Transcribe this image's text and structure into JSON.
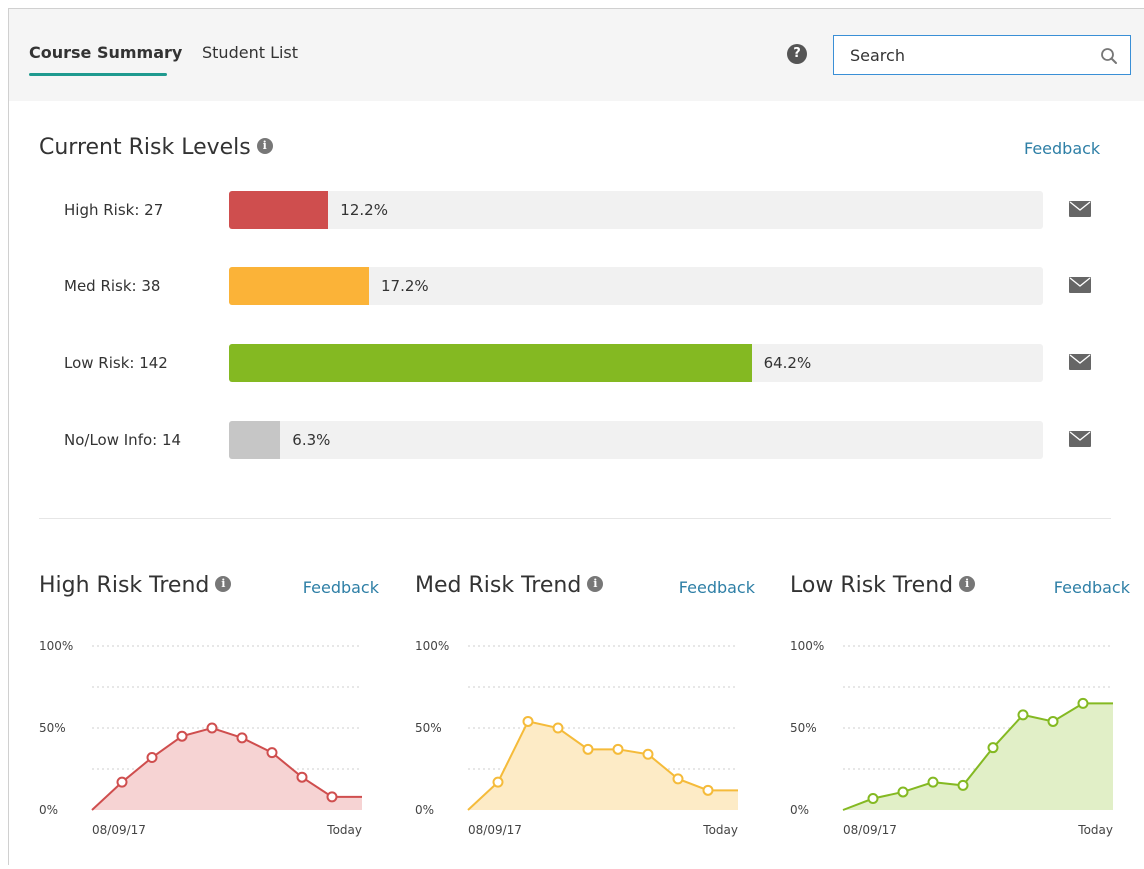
{
  "tabs": [
    {
      "label": "Course Summary",
      "active": true
    },
    {
      "label": "Student List",
      "active": false
    }
  ],
  "help_icon": "?",
  "search": {
    "placeholder": "Search",
    "value": ""
  },
  "risk_levels": {
    "title": "Current Risk Levels",
    "feedback": "Feedback",
    "rows": [
      {
        "label": "High Risk: 27",
        "percent": 12.2,
        "percent_text": "12.2%",
        "color": "#cf4e4e"
      },
      {
        "label": "Med Risk: 38",
        "percent": 17.2,
        "percent_text": "17.2%",
        "color": "#fbb338"
      },
      {
        "label": "Low Risk: 142",
        "percent": 64.2,
        "percent_text": "64.2%",
        "color": "#84b922"
      },
      {
        "label": "No/Low Info: 14",
        "percent": 6.3,
        "percent_text": "6.3%",
        "color": "#c6c6c6"
      }
    ]
  },
  "chart_data": [
    {
      "type": "area",
      "title": "High Risk Trend",
      "feedback": "Feedback",
      "color": "#cf4e4e",
      "fill": "#f6d3d3",
      "yticks": [
        "100%",
        "50%",
        "0%"
      ],
      "ylim": [
        0,
        100
      ],
      "x_labels": [
        "08/09/17",
        "Today"
      ],
      "values": [
        0,
        17,
        32,
        45,
        50,
        44,
        35,
        20,
        8,
        8
      ]
    },
    {
      "type": "area",
      "title": "Med Risk Trend",
      "feedback": "Feedback",
      "color": "#f5bb3a",
      "fill": "#fdebc6",
      "yticks": [
        "100%",
        "50%",
        "0%"
      ],
      "ylim": [
        0,
        100
      ],
      "x_labels": [
        "08/09/17",
        "Today"
      ],
      "values": [
        0,
        17,
        54,
        50,
        37,
        37,
        34,
        19,
        12,
        12
      ]
    },
    {
      "type": "area",
      "title": "Low Risk Trend",
      "feedback": "Feedback",
      "color": "#84b922",
      "fill": "#e1efc7",
      "yticks": [
        "100%",
        "50%",
        "0%"
      ],
      "ylim": [
        0,
        100
      ],
      "x_labels": [
        "08/09/17",
        "Today"
      ],
      "values": [
        0,
        7,
        11,
        17,
        15,
        38,
        58,
        54,
        65,
        65
      ]
    }
  ]
}
